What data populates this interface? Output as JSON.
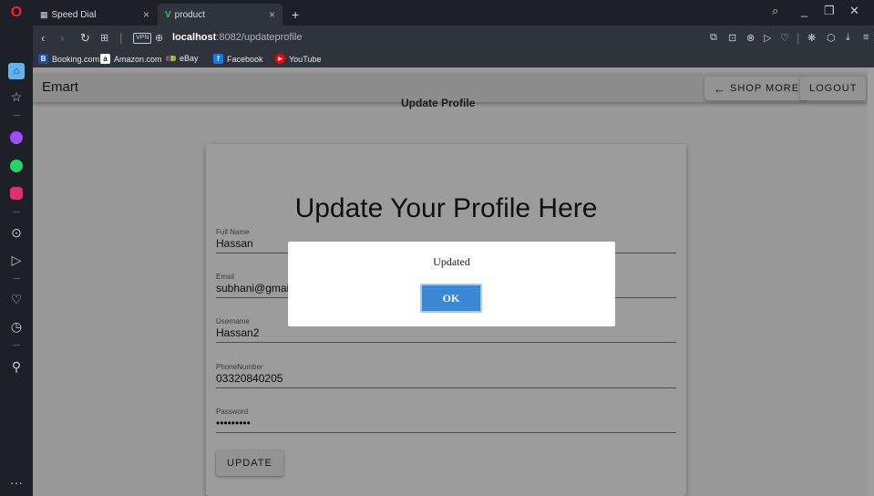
{
  "browser": {
    "tabs": [
      {
        "label": "Speed Dial"
      },
      {
        "label": "product"
      }
    ],
    "new_tab": "+",
    "tab_close": "×",
    "url_host": "localhost",
    "url_rest": ":8082/updateprofile",
    "vpn_label": "VPN",
    "bookmarks": [
      {
        "label": "Booking.com",
        "icon": "booking-icon",
        "color": "#1f4fb4"
      },
      {
        "label": "Amazon.com",
        "icon": "amazon-icon",
        "color": "#ffffff"
      },
      {
        "label": "eBay",
        "icon": "ebay-icon",
        "color": "#e53238"
      },
      {
        "label": "Facebook",
        "icon": "facebook-icon",
        "color": "#1877f2"
      },
      {
        "label": "YouTube",
        "icon": "youtube-icon",
        "color": "#ff0000"
      }
    ],
    "sidebar_more": "···"
  },
  "app": {
    "brand": "Emart",
    "shop_more": "SHOP MORE",
    "logout": "LOGOUT",
    "page_subtitle": "Update Profile"
  },
  "form": {
    "title": "Update Your Profile Here",
    "fields": [
      {
        "label": "Full Name",
        "value": "Hassan"
      },
      {
        "label": "Email",
        "value": "subhani@gmail"
      },
      {
        "label": "Username",
        "value": "Hassan2"
      },
      {
        "label": "PhoneNumber",
        "value": "03320840205"
      },
      {
        "label": "Password",
        "value": "•••••••••"
      }
    ],
    "submit": "UPDATE"
  },
  "dialog": {
    "message": "Updated",
    "ok": "OK",
    "ok_color": "#3a87d6"
  }
}
